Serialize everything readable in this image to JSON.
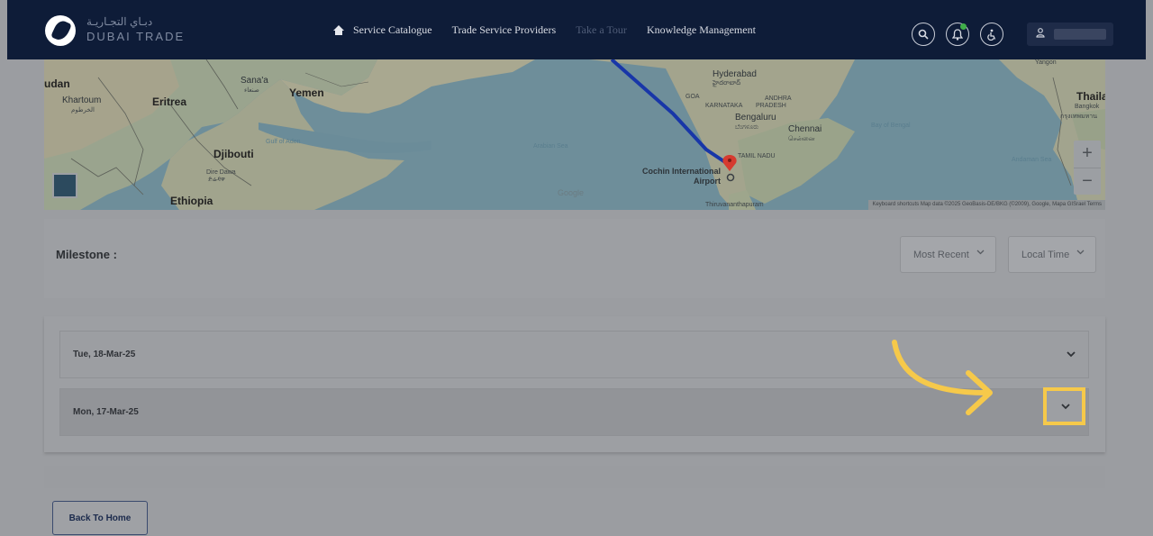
{
  "header": {
    "logo_arabic": "دبـاي التجـاريـة",
    "logo_english": "DUBAI TRADE",
    "nav": [
      {
        "label": "Service Catalogue",
        "icon": "home-icon"
      },
      {
        "label": "Trade Service Providers"
      },
      {
        "label": "Take a Tour"
      },
      {
        "label": "Knowledge Management"
      }
    ],
    "icons": [
      "search-icon",
      "notification-bell-icon",
      "accessibility-icon",
      "user-icon"
    ]
  },
  "map": {
    "labels": {
      "sudan": "udan",
      "khartoum": "Khartoum",
      "khartoum_ar": "الخرطوم",
      "eritrea": "Eritrea",
      "sanaa": "Sana'a",
      "sanaa_ar": "صنعاء",
      "yemen": "Yemen",
      "gulf_aden": "Gulf of Aden",
      "djibouti": "Djibouti",
      "dire_dawa": "Dire Dawa",
      "dire_dawa_local": "ድሬዳዋ",
      "ethiopia": "Ethiopia",
      "arabian_sea": "Arabian Sea",
      "hyderabad": "Hyderabad",
      "hyderabad_local": "హైదరాబాద్",
      "goa": "GOA",
      "andhra": "ANDHRA",
      "karnataka": "KARNATAKA",
      "pradesh": "PRADESH",
      "bengaluru": "Bengaluru",
      "bengaluru_local": "ಬೆಂಗಳೂರು",
      "chennai": "Chennai",
      "chennai_local": "சென்னை",
      "bay_bengal": "Bay of Bengal",
      "tamil_nadu": "TAMIL NADU",
      "cochin_1": "Cochin International",
      "cochin_2": "Airport",
      "thailand": "Thailan",
      "bangkok": "Bangkok",
      "bangkok_local": "กรุงเทพมหาน",
      "andaman": "Andaman Sea",
      "yangon": "Yangon",
      "thiruv": "Thiruvananthapuram"
    },
    "google": "Google",
    "zoom_in": "+",
    "zoom_out": "−",
    "attribution": "Keyboard shortcuts   Map data ©2025 GeoBasis-DE/BKG (©2009), Google, Mapa GISrael   Terms"
  },
  "milestone": {
    "title": "Milestone :",
    "sort_select": "Most Recent",
    "time_select": "Local Time"
  },
  "accordion": {
    "items": [
      {
        "date": "Tue, 18-Mar-25"
      },
      {
        "date": "Mon, 17-Mar-25"
      }
    ]
  },
  "back_button": "Back To Home",
  "colors": {
    "header_bg": "#0e1c38",
    "highlight": "#f6c94a",
    "route_line": "#1836a8",
    "pin": "#d63a2f"
  }
}
